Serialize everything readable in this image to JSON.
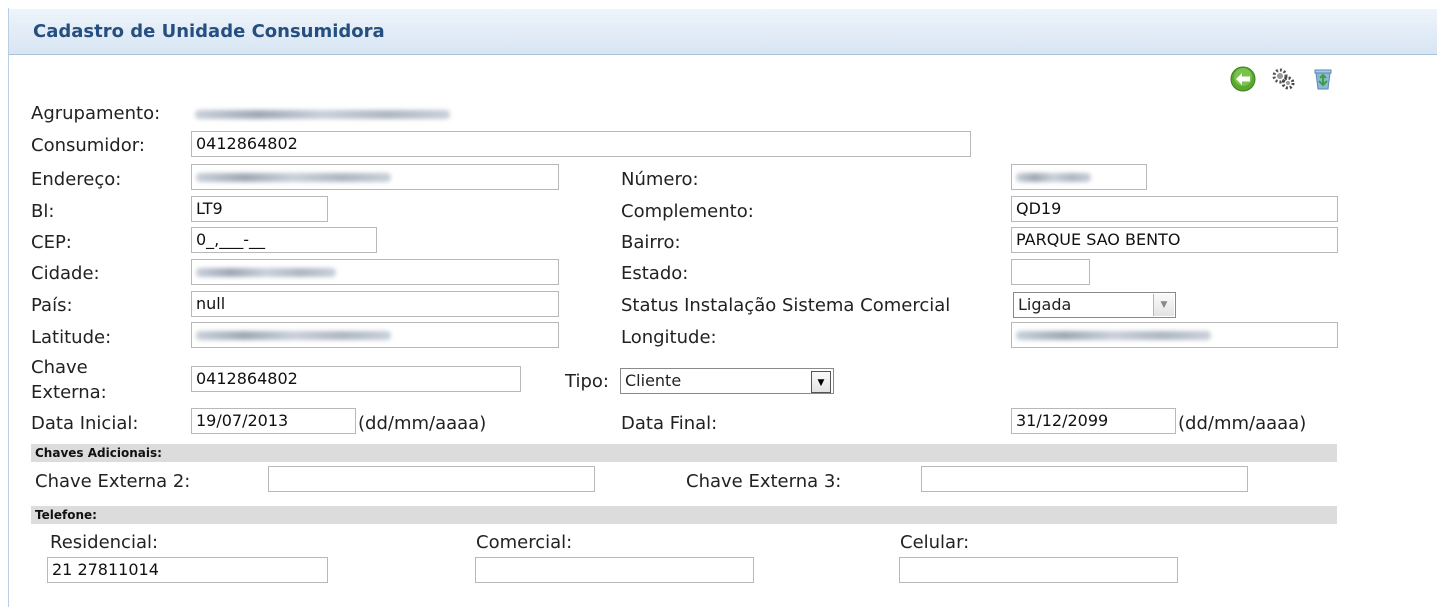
{
  "header": {
    "title": "Cadastro de Unidade Consumidora"
  },
  "toolbar": {
    "icons": [
      "back-arrow-icon",
      "settings-gears-icon",
      "recycle-bin-icon"
    ]
  },
  "labels": {
    "agrupamento": "Agrupamento:",
    "consumidor": "Consumidor:",
    "endereco": "Endereço:",
    "numero": "Número:",
    "bl": "Bl:",
    "complemento": "Complemento:",
    "cep": "CEP:",
    "bairro": "Bairro:",
    "cidade": "Cidade:",
    "estado": "Estado:",
    "pais": "País:",
    "status": "Status Instalação Sistema Comercial",
    "latitude": "Latitude:",
    "longitude": "Longitude:",
    "chave_externa_1": "Chave",
    "chave_externa_2": "Externa:",
    "tipo": "Tipo:",
    "data_inicial": "Data Inicial:",
    "data_final": "Data Final:",
    "date_format": "(dd/mm/aaaa)",
    "chaves_adicionais": "Chaves Adicionais:",
    "chave_externa_ad2": "Chave Externa 2:",
    "chave_externa_ad3": "Chave Externa 3:",
    "telefone": "Telefone:",
    "residencial": "Residencial:",
    "comercial": "Comercial:",
    "celular": "Celular:"
  },
  "values": {
    "consumidor": "0412864802",
    "bl": "LT9",
    "complemento": "QD19",
    "cep": "0_,___-__",
    "bairro": "PARQUE SAO BENTO",
    "estado": "",
    "pais": "null",
    "status": "Ligada",
    "chave_externa": "0412864802",
    "tipo": "Cliente",
    "data_inicial": "19/07/2013",
    "data_final": "31/12/2099",
    "chave_externa_ad2": "",
    "chave_externa_ad3": "",
    "residencial": "21 27811014",
    "comercial": "",
    "celular": ""
  },
  "colors": {
    "header_text": "#244f80",
    "header_bg": "#dde9f5",
    "section_bar": "#dcdcdc"
  }
}
